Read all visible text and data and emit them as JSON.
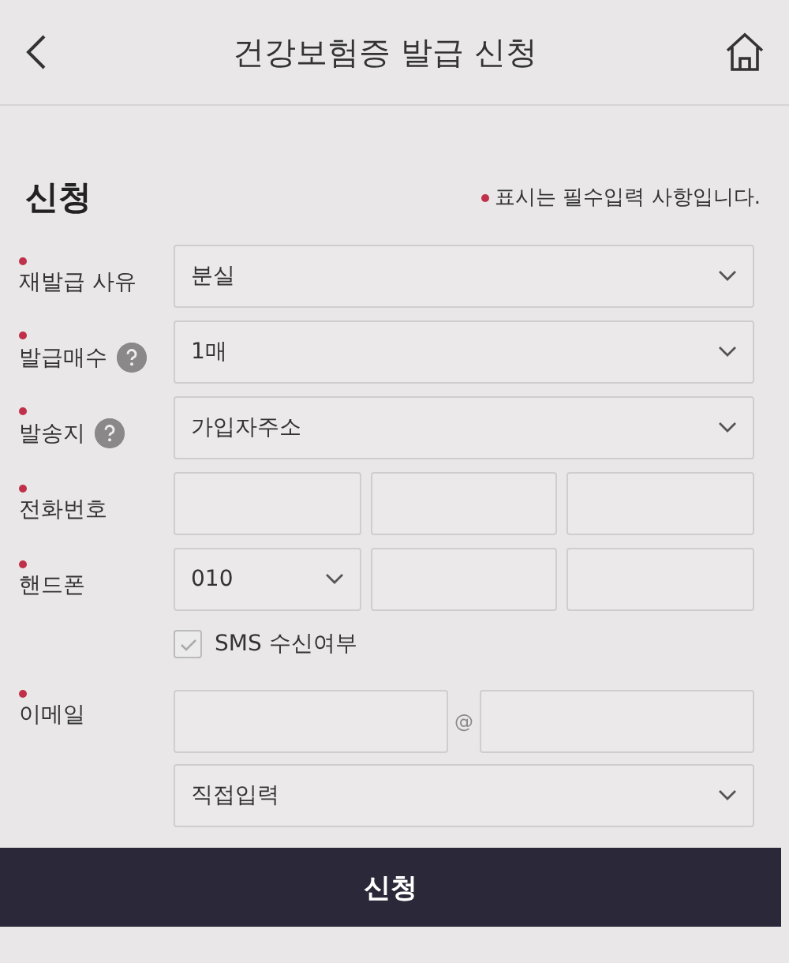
{
  "header": {
    "title": "건강보험증 발급 신청"
  },
  "section": {
    "title": "신청",
    "note": "표시는 필수입력 사항입니다."
  },
  "rows": [
    {
      "kind": "select",
      "label": "재발급 사유",
      "required": true,
      "help": false,
      "value": "분실"
    },
    {
      "kind": "select",
      "label": "발급매수",
      "required": true,
      "help": true,
      "value": "1매"
    },
    {
      "kind": "select",
      "label": "발송지",
      "required": true,
      "help": true,
      "value": "가입자주소"
    },
    {
      "kind": "triple",
      "label": "전화번호",
      "required": true,
      "help": false
    },
    {
      "kind": "phone",
      "label": "핸드폰",
      "required": true,
      "help": false,
      "value": "010"
    },
    {
      "kind": "checkbox",
      "label": "SMS 수신여부",
      "checked": true
    },
    {
      "kind": "email",
      "label": "이메일",
      "required": true,
      "help": false,
      "at": "@",
      "domain": "직접입력"
    }
  ],
  "submit": {
    "label": "신청"
  }
}
